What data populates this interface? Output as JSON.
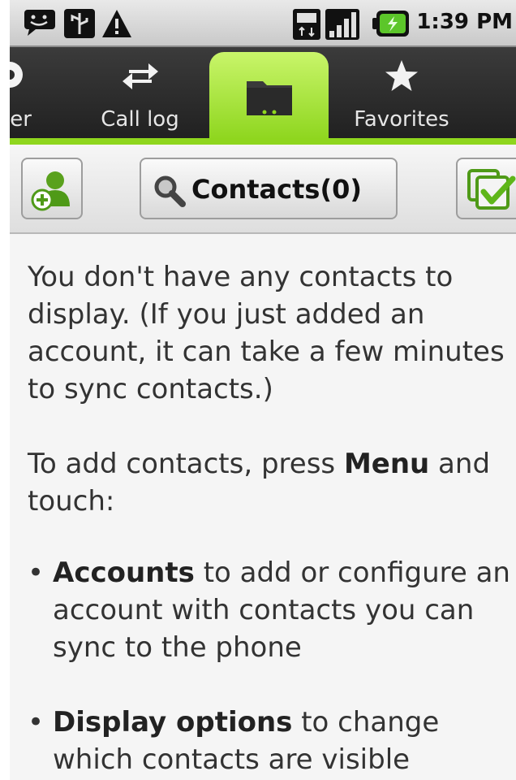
{
  "status_bar": {
    "time": "1:39 PM",
    "icons": [
      "talk-icon",
      "usb-icon",
      "warning-icon",
      "3g-icon",
      "signal-icon",
      "battery-charging-icon"
    ]
  },
  "tabs": [
    {
      "id": "dialer",
      "label": "Dialer",
      "visible_label": "ler",
      "icon": "phone-icon",
      "selected": false
    },
    {
      "id": "call_log",
      "label": "Call log",
      "icon": "call-log-arrows-icon",
      "selected": false
    },
    {
      "id": "contacts",
      "label": "",
      "icon": "folder-icon",
      "selected": true
    },
    {
      "id": "favorites",
      "label": "Favorites",
      "icon": "star-icon",
      "selected": false
    }
  ],
  "action_bar": {
    "search_label": "Contacts(0)"
  },
  "empty_message": {
    "p1": "You don't have any contacts to display. (If you just added an account, it can take a few minutes to sync contacts.)",
    "p2_before": "To add contacts, press ",
    "p2_bold": "Menu",
    "p2_after": " and touch:",
    "bullets": [
      {
        "bold": "Accounts",
        "text": " to add or configure an account with contacts you can sync to the phone"
      },
      {
        "bold": "Display options",
        "text": " to change which contacts are visible"
      }
    ],
    "bullet_glyph": "•"
  },
  "colors": {
    "accent_green": "#8fd61e",
    "tabbar_bg": "#2b2b2b",
    "content_bg": "#f5f5f5"
  }
}
